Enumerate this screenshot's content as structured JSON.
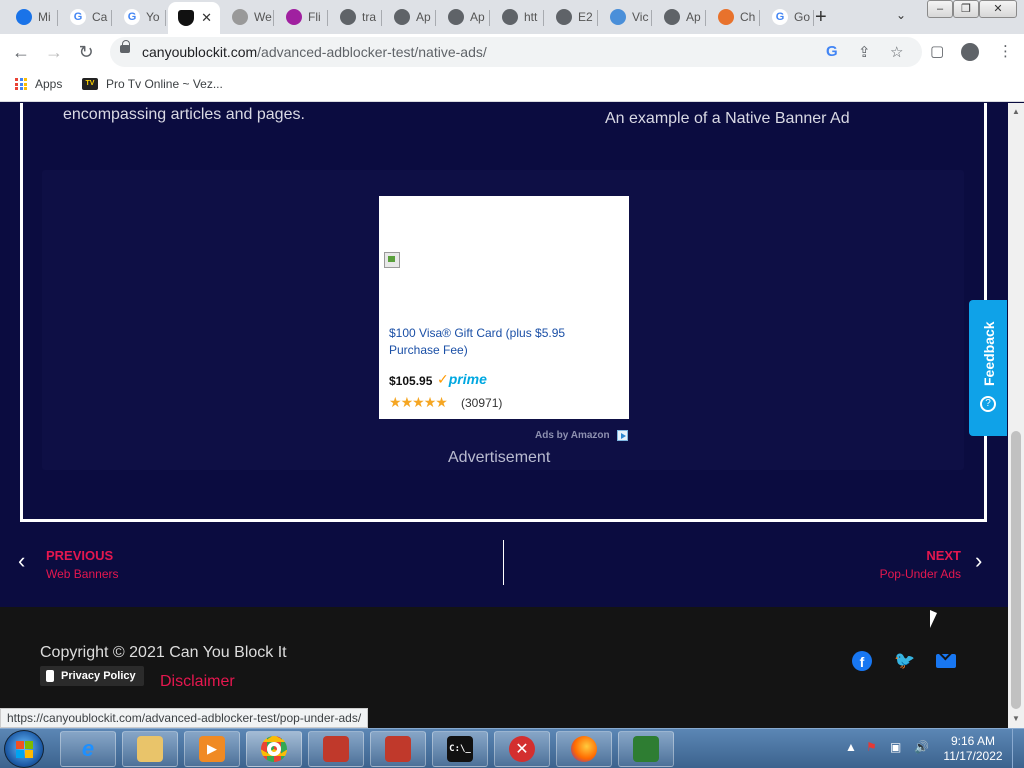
{
  "browser": {
    "tabs": [
      {
        "title": "Mi",
        "icon": "diamond-logo-icon",
        "color": "#1a73e8"
      },
      {
        "title": "Ca",
        "icon": "google-icon",
        "color": "#4285f4"
      },
      {
        "title": "Yo",
        "icon": "google-icon",
        "color": "#4285f4"
      },
      {
        "title": "",
        "icon": "shield-icon",
        "color": "#111111",
        "active": true
      },
      {
        "title": "We",
        "icon": "shell-icon",
        "color": "#999999"
      },
      {
        "title": "Fli",
        "icon": "flame-icon",
        "color": "#a020a0"
      },
      {
        "title": "tra",
        "icon": "globe-icon",
        "color": "#5f6368"
      },
      {
        "title": "Ap",
        "icon": "globe-icon",
        "color": "#5f6368"
      },
      {
        "title": "Ap",
        "icon": "globe-icon",
        "color": "#5f6368"
      },
      {
        "title": "htt",
        "icon": "globe-icon",
        "color": "#5f6368"
      },
      {
        "title": "E2",
        "icon": "globe-icon",
        "color": "#5f6368"
      },
      {
        "title": "Vic",
        "icon": "hexagon-icon",
        "color": "#4a8fd9"
      },
      {
        "title": "Ap",
        "icon": "globe-icon",
        "color": "#5f6368"
      },
      {
        "title": "Ch",
        "icon": "rainbow-icon",
        "color": "#e8722c"
      },
      {
        "title": "Go",
        "icon": "google-icon",
        "color": "#4285f4"
      }
    ],
    "url_host": "canyoublockit.com",
    "url_path": "/advanced-adblocker-test/native-ads/",
    "bookmarks": [
      {
        "label": "Apps"
      },
      {
        "label": "Pro Tv Online ~ Vez..."
      }
    ],
    "status_url": "https://canyoublockit.com/advanced-adblocker-test/pop-under-ads/"
  },
  "page": {
    "lead_text": "encompassing articles and pages.",
    "caption": "An example of a Native Banner Ad",
    "ad": {
      "title": "$100 Visa® Gift Card (plus $5.95 Purchase Fee)",
      "price": "$105.95",
      "prime_label": "prime",
      "rating_stars": 5,
      "reviews": "(30971)",
      "ads_by": "Ads by Amazon"
    },
    "advertisement_label": "Advertisement",
    "nav": {
      "prev_label": "PREVIOUS",
      "prev_title": "Web Banners",
      "next_label": "NEXT",
      "next_title": "Pop-Under Ads"
    },
    "footer": {
      "copyright": "Copyright © 2021 Can You Block It",
      "privacy": "Privacy Policy",
      "disclaimer": "Disclaimer"
    },
    "feedback_label": "Feedback"
  },
  "taskbar": {
    "time": "9:16 AM",
    "date": "11/17/2022"
  },
  "colors": {
    "page_bg": "#0b0c40",
    "accent_pink": "#e5174f",
    "feedback_blue": "#0fa2e8"
  }
}
